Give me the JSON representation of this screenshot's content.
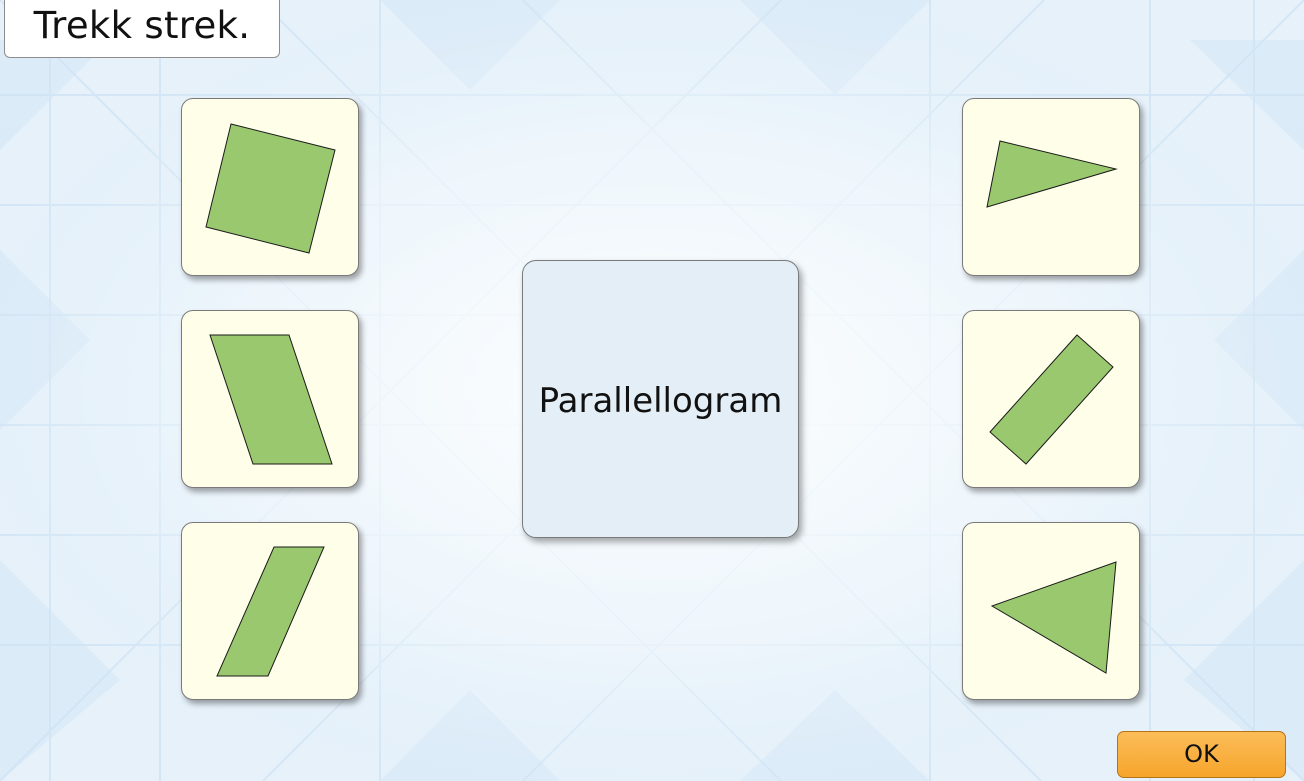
{
  "instruction": "Trekk strek.",
  "center_card": {
    "label": "Parallellogram"
  },
  "ok_button": {
    "label": "OK"
  },
  "colors": {
    "shape_fill": "#9ac86f",
    "card_fill": "#fefee9",
    "center_card_fill": "#e3eef7",
    "button_fill": "#f8ad3c"
  },
  "left_cards": [
    {
      "shape": "square"
    },
    {
      "shape": "parallelogram"
    },
    {
      "shape": "parallelogram"
    }
  ],
  "right_cards": [
    {
      "shape": "triangle"
    },
    {
      "shape": "rectangle"
    },
    {
      "shape": "triangle"
    }
  ]
}
